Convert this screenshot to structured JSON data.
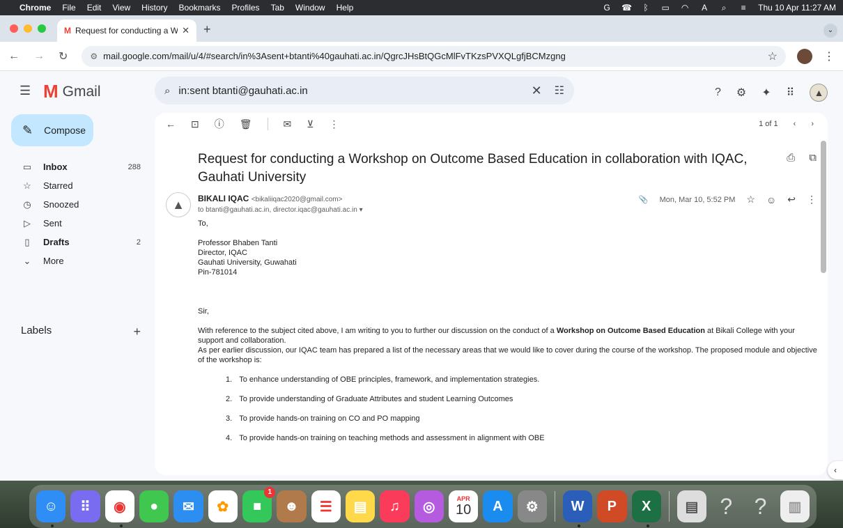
{
  "menubar": {
    "app": "Chrome",
    "items": [
      "File",
      "Edit",
      "View",
      "History",
      "Bookmarks",
      "Profiles",
      "Tab",
      "Window",
      "Help"
    ],
    "clock": "Thu 10 Apr  11:27 AM"
  },
  "browser": {
    "tab_title": "Request for conducting a Wo",
    "url": "mail.google.com/mail/u/4/#search/in%3Asent+btanti%40gauhati.ac.in/QgrcJHsBtQGcMlFvTKzsPVXQLgfjBCMzgng"
  },
  "gmail": {
    "logo_text": "Gmail",
    "search_query": "in:sent btanti@gauhati.ac.in",
    "compose_label": "Compose",
    "nav": [
      {
        "label": "Inbox",
        "count": "288",
        "icon": "inbox-icon"
      },
      {
        "label": "Starred",
        "count": "",
        "icon": "star-icon"
      },
      {
        "label": "Snoozed",
        "count": "",
        "icon": "clock-icon"
      },
      {
        "label": "Sent",
        "count": "",
        "icon": "send-icon"
      },
      {
        "label": "Drafts",
        "count": "2",
        "icon": "draft-icon"
      },
      {
        "label": "More",
        "count": "",
        "icon": "chevron-down-icon"
      }
    ],
    "labels_heading": "Labels",
    "pagination": "1 of 1"
  },
  "email": {
    "subject": "Request for conducting a Workshop on Outcome Based Education in collaboration with IQAC, Gauhati University",
    "sender_name": "BIKALI IQAC",
    "sender_email": "<bikaliiqac2020@gmail.com>",
    "to_line": "to btanti@gauhati.ac.in, director.iqac@gauhati.ac.in",
    "date": "Mon, Mar 10, 5:52 PM",
    "salutation_to": "To,",
    "addr1": "Professor Bhaben Tanti",
    "addr2": "Director, IQAC",
    "addr3": "Gauhati University, Guwahati",
    "addr4": "Pin-781014",
    "sir": "Sir,",
    "para1_a": "With reference to the subject cited above, I am writing to you to further our discussion on the conduct of a ",
    "para1_b": "Workshop on Outcome Based Education",
    "para1_c": " at Bikali College with your support and collaboration.",
    "para2": "As per earlier discussion, our IQAC team has prepared a list of the necessary areas that we would like to cover during the course of the workshop. The proposed module and objective of the workshop is:",
    "items": [
      {
        "n": "1.",
        "text": "To enhance understanding of OBE principles, framework, and implementation strategies."
      },
      {
        "n": "2.",
        "text": "To provide understanding of Graduate Attributes and student Learning Outcomes"
      },
      {
        "n": "3.",
        "text": "To provide hands-on training on CO and PO mapping"
      },
      {
        "n": "4.",
        "text": "To provide hands-on training on teaching methods and assessment in alignment with OBE"
      }
    ]
  },
  "dock": {
    "facetime_badge": "1",
    "calendar_month": "APR",
    "calendar_day": "10"
  }
}
